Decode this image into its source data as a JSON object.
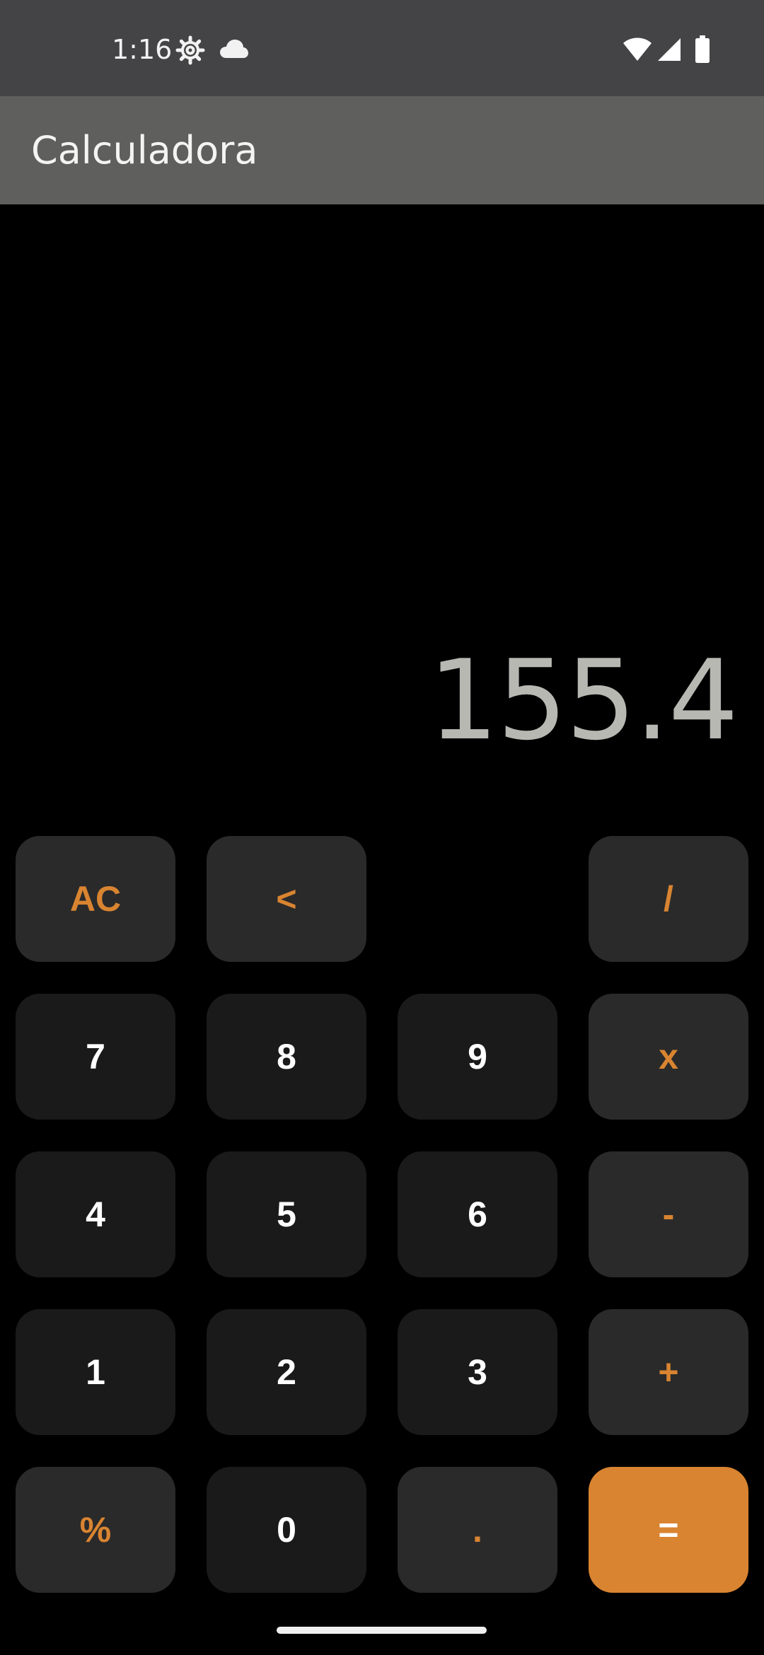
{
  "status_bar": {
    "time": "1:16",
    "icons": [
      "settings-gear-icon",
      "cloud-icon",
      "wifi-icon",
      "cellular-signal-icon",
      "battery-icon"
    ]
  },
  "app_bar": {
    "title": "Calculadora"
  },
  "display": {
    "value": "155.4"
  },
  "keypad": {
    "row1": {
      "clear": "AC",
      "backspace": "<",
      "divide": "/"
    },
    "row2": {
      "seven": "7",
      "eight": "8",
      "nine": "9",
      "multiply": "x"
    },
    "row3": {
      "four": "4",
      "five": "5",
      "six": "6",
      "subtract": "-"
    },
    "row4": {
      "one": "1",
      "two": "2",
      "three": "3",
      "add": "+"
    },
    "row5": {
      "percent": "%",
      "zero": "0",
      "decimal": ".",
      "equals": "="
    }
  },
  "colors": {
    "accent": "#d98431",
    "number_key_bg": "#1a1a1a",
    "function_key_bg": "#2a2a2a",
    "display_text": "#b7b8b2",
    "app_bar_bg": "#5f5f5d",
    "status_bar_bg": "#444345"
  }
}
